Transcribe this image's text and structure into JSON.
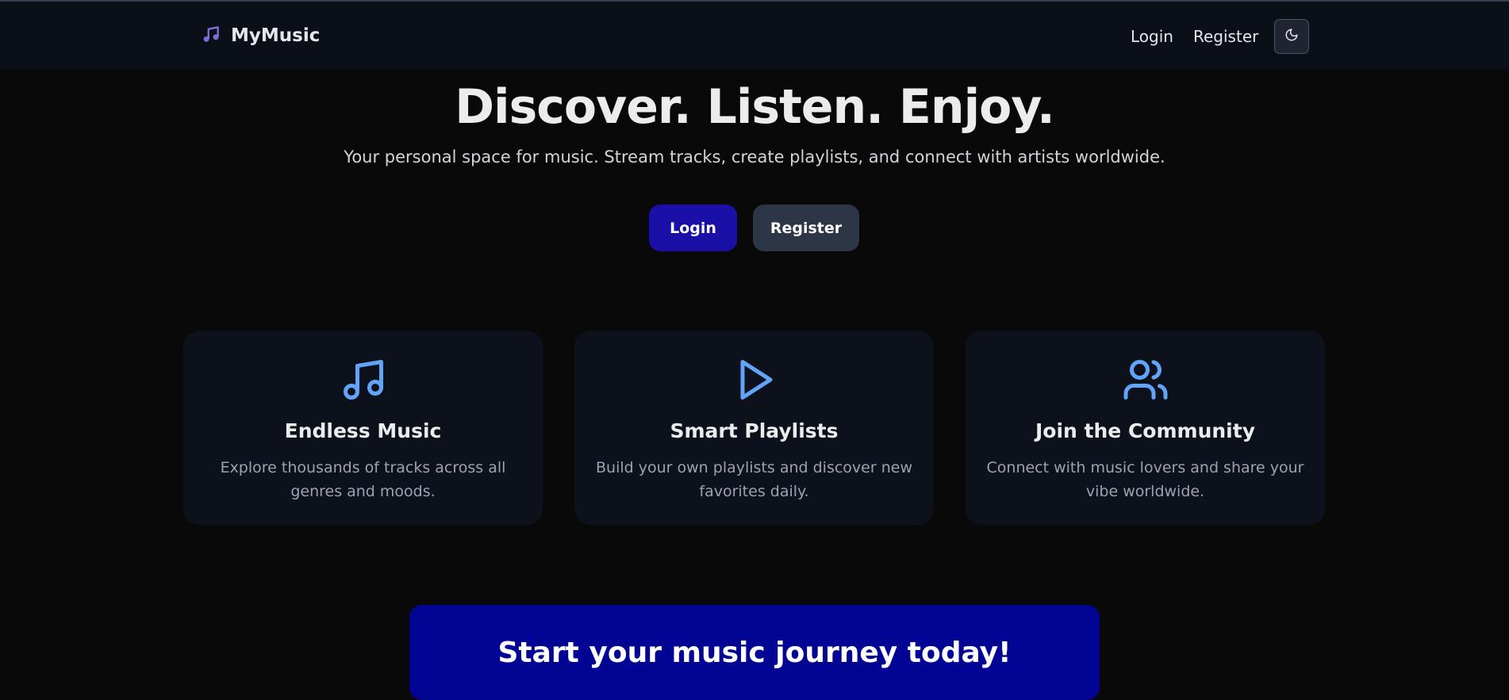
{
  "nav": {
    "brand": "MyMusic",
    "brand_icon": "music-note-icon",
    "login_label": "Login",
    "register_label": "Register",
    "theme_icon": "moon-icon"
  },
  "hero": {
    "title": "Discover. Listen. Enjoy.",
    "subtitle": "Your personal space for music. Stream tracks, create playlists, and connect with artists worldwide.",
    "login_label": "Login",
    "register_label": "Register"
  },
  "features": [
    {
      "icon": "music-icon",
      "title": "Endless Music",
      "description": "Explore thousands of tracks across all genres and moods."
    },
    {
      "icon": "play-icon",
      "title": "Smart Playlists",
      "description": "Build your own playlists and discover new favorites daily."
    },
    {
      "icon": "users-icon",
      "title": "Join the Community",
      "description": "Connect with music lovers and share your vibe worldwide."
    }
  ],
  "cta": {
    "title": "Start your music journey today!"
  },
  "colors": {
    "background": "#090909",
    "nav_background": "#0b0f17",
    "primary_button": "#1a0fa6",
    "secondary_button": "#2d3646",
    "card_background": "#0d111b",
    "icon_accent": "#60a5fa",
    "brand_icon": "#7c6fd8",
    "cta_background": "#020494"
  }
}
